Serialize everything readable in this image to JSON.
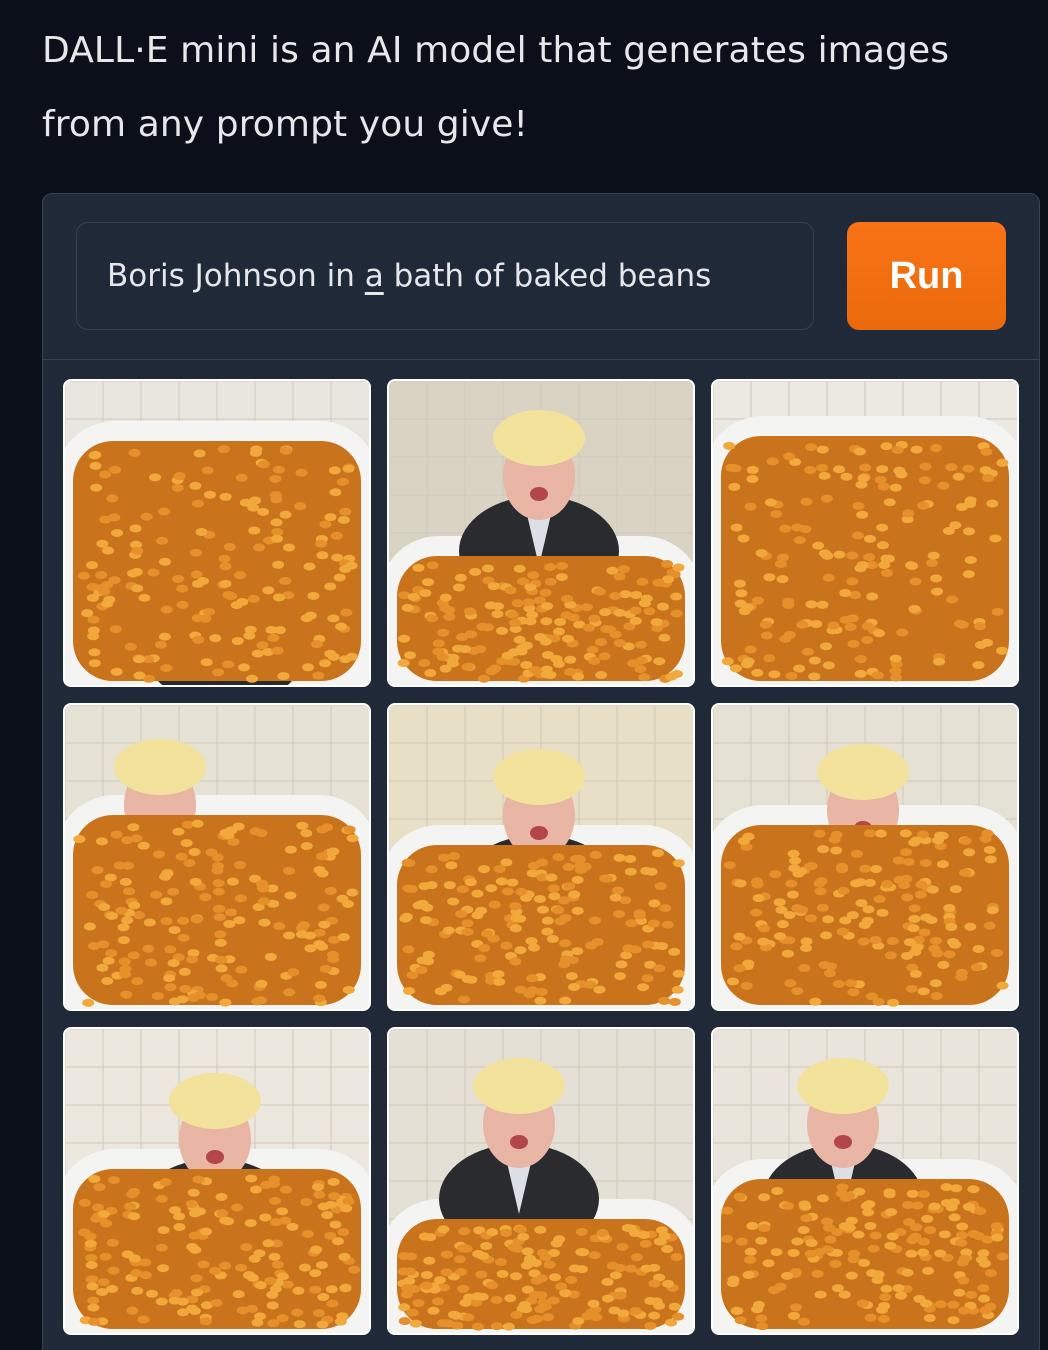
{
  "intro": {
    "text": "DALL·E mini is an AI model that generates images from any prompt you give!"
  },
  "prompt": {
    "before": "Boris Johnson in ",
    "underlined": "a",
    "after": " bath of baked beans"
  },
  "run_button": {
    "label": "Run"
  },
  "gallery": {
    "image_count": 9,
    "subject": "Boris Johnson in a bath of baked beans"
  },
  "colors": {
    "background": "#0b0f19",
    "panel": "#1f2937",
    "border": "#374151",
    "accent": "#f97316",
    "text": "#e5e7eb"
  }
}
